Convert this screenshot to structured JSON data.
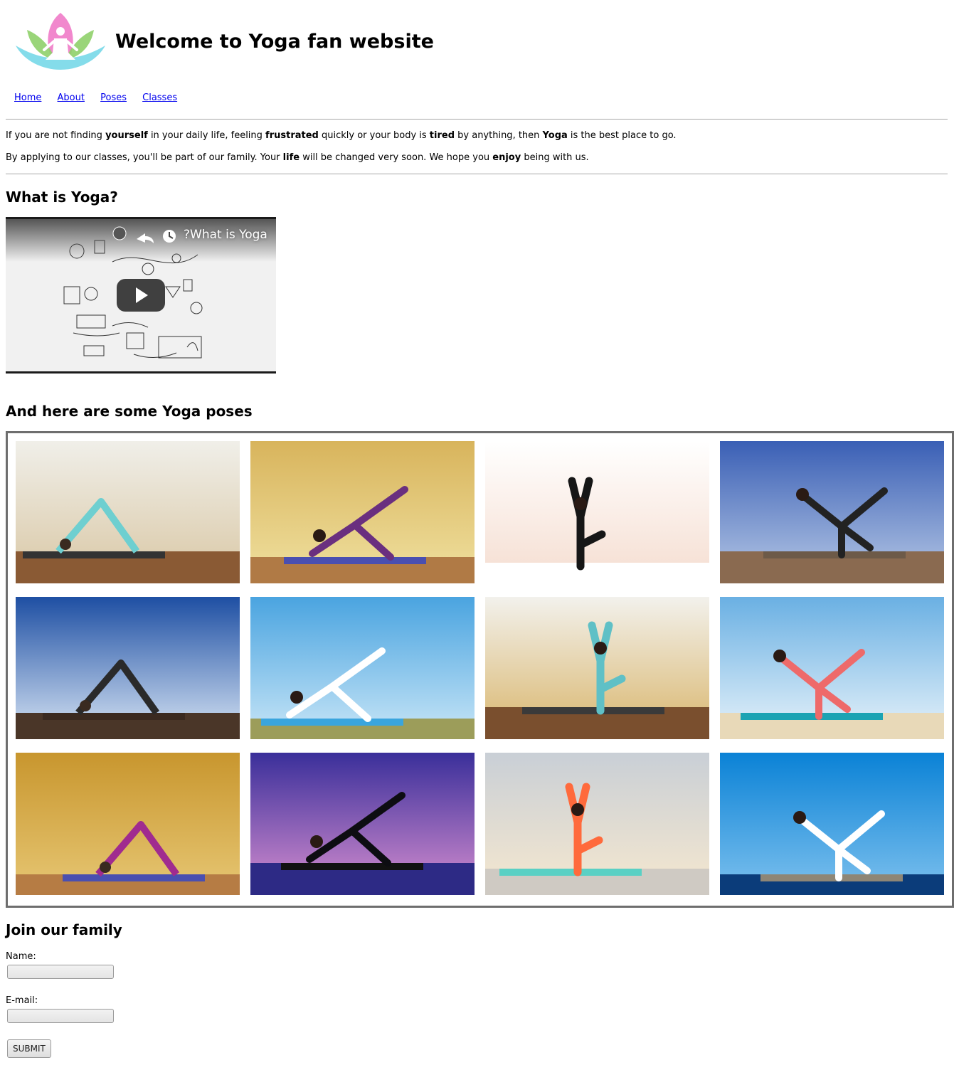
{
  "site": {
    "title": "Welcome to Yoga fan website",
    "logo_icon": "lotus-meditation-icon"
  },
  "nav": [
    {
      "label": "Home"
    },
    {
      "label": "About"
    },
    {
      "label": "Poses"
    },
    {
      "label": "Classes"
    }
  ],
  "intro": {
    "p1": [
      {
        "t": "If you are not finding ",
        "b": false
      },
      {
        "t": "yourself",
        "b": true
      },
      {
        "t": " in your daily life, feeling ",
        "b": false
      },
      {
        "t": "frustrated",
        "b": true
      },
      {
        "t": " quickly or your body is ",
        "b": false
      },
      {
        "t": "tired",
        "b": true
      },
      {
        "t": " by anything, then ",
        "b": false
      },
      {
        "t": "Yoga",
        "b": true
      },
      {
        "t": " is the best place to go.",
        "b": false
      }
    ],
    "p2": [
      {
        "t": "By applying to our classes, you'll be part of our family. Your ",
        "b": false
      },
      {
        "t": "life",
        "b": true
      },
      {
        "t": " will be changed very soon. We hope you ",
        "b": false
      },
      {
        "t": "enjoy",
        "b": true
      },
      {
        "t": " being with us.",
        "b": false
      }
    ]
  },
  "video_section": {
    "heading": "What is Yoga?",
    "video_title": "?What is Yoga",
    "play_icon": "play-icon",
    "share_icon": "share-icon",
    "watch_later_icon": "clock-icon"
  },
  "poses_section": {
    "heading": "And here are some Yoga poses"
  },
  "gallery": [
    {
      "pose": "downward-dog",
      "bg": [
        "#f0efe9",
        "#d9c7a4"
      ],
      "floor": "#8a5a34",
      "mat": "#333333",
      "body": "#6ecfd0"
    },
    {
      "pose": "three-legged-dog",
      "bg": [
        "#d8b45c",
        "#f0e1a0"
      ],
      "floor": "#b07a45",
      "mat": "#4a4fb0",
      "body": "#6a2f7f"
    },
    {
      "pose": "crow",
      "bg": [
        "#ffffff",
        "#f5ddd0"
      ],
      "floor": "#ffffff",
      "mat": "#ffffff",
      "body": "#161616"
    },
    {
      "pose": "wheel-leg-up",
      "bg": [
        "#3a5fb5",
        "#b7c9e6"
      ],
      "floor": "#8a6a50",
      "mat": "#6d5a48",
      "body": "#222222"
    },
    {
      "pose": "dancer-rock",
      "bg": [
        "#1e4fa3",
        "#d9e6f5"
      ],
      "floor": "#4a3628",
      "mat": "#3a2a20",
      "body": "#2a2a2a"
    },
    {
      "pose": "tree-field",
      "bg": [
        "#4aa4e0",
        "#c9e6f7"
      ],
      "floor": "#9c9d5a",
      "mat": "#3aa5dd",
      "body": "#ffffff"
    },
    {
      "pose": "eagle-brick",
      "bg": [
        "#f2f1ec",
        "#d9b56b"
      ],
      "floor": "#7a4f2e",
      "mat": "#3a3a3a",
      "body": "#5fc0c6"
    },
    {
      "pose": "plank-beach",
      "bg": [
        "#6ab0e3",
        "#e8f3fa"
      ],
      "floor": "#e8d9b8",
      "mat": "#1ba3b3",
      "body": "#ee6a6a"
    },
    {
      "pose": "warrior-twist",
      "bg": [
        "#c8962e",
        "#e7c774"
      ],
      "floor": "#b67c44",
      "mat": "#4a4fb0",
      "body": "#a02b8f"
    },
    {
      "pose": "dancer-silhouette",
      "bg": [
        "#3a2f9a",
        "#d78fd0"
      ],
      "floor": "#2d2a85",
      "mat": "#111111",
      "body": "#0d0d12"
    },
    {
      "pose": "pigeon-roof",
      "bg": [
        "#c9cfd6",
        "#f6e8cf"
      ],
      "floor": "#cfcac3",
      "mat": "#5ad0c4",
      "body": "#ff6a3c"
    },
    {
      "pose": "bow-sea",
      "bg": [
        "#0a82d6",
        "#7ec1ee"
      ],
      "floor": "#0b3c7a",
      "mat": "#8e8676",
      "body": "#ffffff"
    }
  ],
  "join": {
    "heading": "Join our family",
    "name_label": "Name:",
    "email_label": "E-mail:",
    "name_value": "",
    "email_value": "",
    "submit_label": "SUBMIT"
  }
}
